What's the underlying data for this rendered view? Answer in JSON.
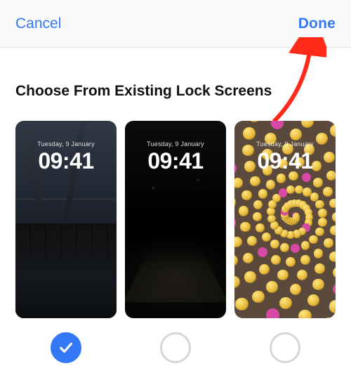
{
  "colors": {
    "accent": "#3478f6",
    "arrow": "#ff2a1a"
  },
  "header": {
    "cancel_label": "Cancel",
    "done_label": "Done"
  },
  "section": {
    "title": "Choose From Existing Lock Screens"
  },
  "screens": [
    {
      "date": "Tuesday, 9 January",
      "time": "09:41",
      "selected": true,
      "style": "city-dusk"
    },
    {
      "date": "Tuesday, 9 January",
      "time": "09:41",
      "selected": false,
      "style": "night-street"
    },
    {
      "date": "Tuesday, 9 January",
      "time": "09:41",
      "selected": false,
      "style": "emoji-spiral"
    }
  ],
  "annotation": {
    "arrow_points_to": "done-button"
  }
}
